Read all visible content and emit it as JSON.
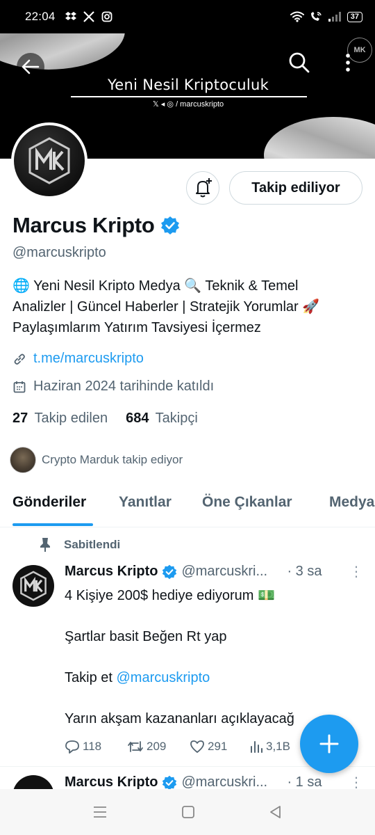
{
  "status_bar": {
    "time": "22:04",
    "battery": "37",
    "left_icons": [
      "dropbox-icon",
      "x-icon",
      "instagram-icon"
    ],
    "right_icons": [
      "wifi-icon",
      "wifi-calling-icon",
      "signal-icon",
      "battery-icon"
    ]
  },
  "banner": {
    "title": "Yeni Nesil Kriptoculuk",
    "social_handle": "/ marcuskripto",
    "avatar_initials": "MK"
  },
  "profile": {
    "display_name": "Marcus Kripto",
    "handle": "@marcuskripto",
    "bio_line1": "🌐 Yeni Nesil Kripto Medya 🔍 Teknik & Temel",
    "bio_line2": "Analizler | Güncel Haberler | Stratejik Yorumlar 🚀",
    "bio_line3": "Paylaşımlarım Yatırım Tavsiyesi İçermez",
    "link": "t.me/marcuskripto",
    "joined": "Haziran 2024 tarihinde katıldı",
    "following_count": "27",
    "following_label": "Takip edilen",
    "followers_count": "684",
    "followers_label": "Takipçi",
    "followed_by": "Crypto Marduk takip ediyor",
    "follow_button": "Takip ediliyor"
  },
  "tabs": [
    {
      "label": "Gönderiler",
      "active": true
    },
    {
      "label": "Yanıtlar",
      "active": false
    },
    {
      "label": "Öne Çıkanlar",
      "active": false
    },
    {
      "label": "Medya",
      "active": false
    }
  ],
  "pinned_tweet": {
    "pinned_label": "Sabitlendi",
    "name": "Marcus Kripto",
    "handle": "@marcuskri...",
    "time": "· 3 sa",
    "line1": "4 Kişiye 200$ hediye ediyorum 💵",
    "line2": "Şartlar basit Beğen Rt yap",
    "line3_prefix": "Takip et ",
    "line3_mention": "@marcuskripto",
    "line4": "Yarın akşam kazananları açıklayacağ",
    "replies": "118",
    "retweets": "209",
    "likes": "291",
    "views": "3,1B"
  },
  "second_tweet": {
    "name": "Marcus Kripto",
    "handle": "@marcuskri...",
    "time": "· 1 sa"
  },
  "colors": {
    "accent": "#1d9bf0",
    "text_primary": "#0f1419",
    "text_secondary": "#536471",
    "banner_bg": "#000000"
  }
}
